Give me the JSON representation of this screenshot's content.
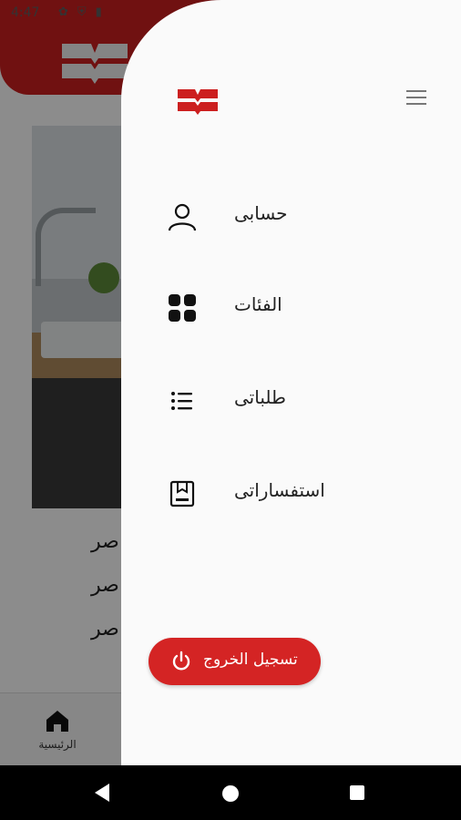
{
  "status_bar": {
    "time": "4:47",
    "left_icons": [
      "settings-icon",
      "shield-icon",
      "battery-saver-icon"
    ],
    "right_icons": [
      "wifi-icon",
      "signal-icon",
      "battery-icon"
    ]
  },
  "background": {
    "lines": [
      "صر",
      "صر",
      "صر"
    ],
    "bottom_nav": {
      "home_label": "الرئيسية"
    }
  },
  "drawer": {
    "logo": "brand-logo",
    "menu_icon": "menu-icon",
    "items": [
      {
        "label": "حسابى",
        "icon": "person-icon"
      },
      {
        "label": "الفئات",
        "icon": "grid-icon"
      },
      {
        "label": "طلباتى",
        "icon": "list-icon"
      },
      {
        "label": "استفساراتى",
        "icon": "inquiry-icon"
      }
    ],
    "logout": {
      "label": "تسجيل الخروج",
      "icon": "power-icon"
    }
  },
  "colors": {
    "brand_red": "#cc1f1f",
    "logout_red": "#d42424",
    "drawer_bg": "#fafafa"
  }
}
